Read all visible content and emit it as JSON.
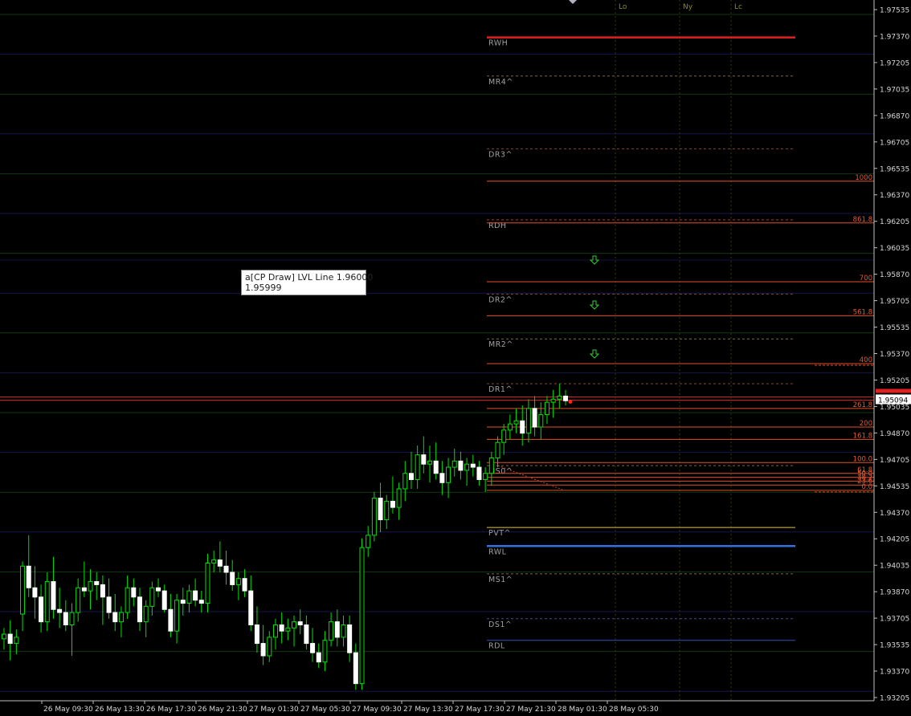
{
  "chart_data": {
    "type": "candlestick",
    "y_axis_ticks": [
      "1.97535",
      "1.97370",
      "1.97205",
      "1.97035",
      "1.96870",
      "1.96705",
      "1.96535",
      "1.96370",
      "1.96205",
      "1.96035",
      "1.95870",
      "1.95705",
      "1.95535",
      "1.95370",
      "1.95205",
      "1.95035",
      "1.94870",
      "1.94705",
      "1.94535",
      "1.94370",
      "1.94205",
      "1.94035",
      "1.93870",
      "1.93705",
      "1.93535",
      "1.93370",
      "1.93205"
    ],
    "ylim": [
      1.9317,
      1.9762
    ],
    "x_axis_ticks": [
      "26 May 09:30",
      "26 May 13:30",
      "26 May 17:30",
      "26 May 21:30",
      "27 May 01:30",
      "27 May 05:30",
      "27 May 09:30",
      "27 May 13:30",
      "27 May 17:30",
      "27 May 21:30",
      "28 May 01:30",
      "28 May 05:30"
    ],
    "current_price": "1.95094",
    "current_price_value": 1.95094,
    "session_markers": [
      {
        "label": "Lo",
        "color": "#8a8a2a"
      },
      {
        "label": "Ny",
        "color": "#8a8a2a"
      },
      {
        "label": "Lc",
        "color": "#8a8a2a"
      }
    ],
    "pivot_levels": [
      {
        "label": "RWH",
        "value": 1.9744,
        "color": "#e02020",
        "style": "solid-thick"
      },
      {
        "label": "MR4^",
        "value": 1.9719,
        "color": "#7a6a4a",
        "style": "dashed"
      },
      {
        "label": "DR3^",
        "value": 1.9672,
        "color": "#7a4a3a",
        "style": "dashed"
      },
      {
        "label": "RDH",
        "value": 1.9626,
        "color": "#a04030",
        "style": "dashed"
      },
      {
        "label": "DR2^",
        "value": 1.9578,
        "color": "#7a4a3a",
        "style": "dashed"
      },
      {
        "label": "MR2^",
        "value": 1.9549,
        "color": "#7a6a4a",
        "style": "dashed"
      },
      {
        "label": "DR1^",
        "value": 1.952,
        "color": "#7a4a3a",
        "style": "dashed"
      },
      {
        "label": "MS0^",
        "value": 1.9467,
        "color": "#7a6a4a",
        "style": "dashed"
      },
      {
        "label": "PVT^",
        "value": 1.9427,
        "color": "#e0c050",
        "style": "solid"
      },
      {
        "label": "RWL",
        "value": 1.9415,
        "color": "#3070e0",
        "style": "solid-thick"
      },
      {
        "label": "MS1^",
        "value": 1.9397,
        "color": "#7a6a4a",
        "style": "dashed"
      },
      {
        "label": "DS1^",
        "value": 1.9368,
        "color": "#4a4a8a",
        "style": "dashed"
      },
      {
        "label": "RDL",
        "value": 1.9354,
        "color": "#3050c0",
        "style": "solid"
      }
    ],
    "fib_levels": [
      {
        "label": "1000",
        "value": 1.9651
      },
      {
        "label": "861.8",
        "value": 1.9624
      },
      {
        "label": "700",
        "value": 1.9586
      },
      {
        "label": "561.8",
        "value": 1.9564
      },
      {
        "label": "400",
        "value": 1.9533
      },
      {
        "label": "261.8",
        "value": 1.9504
      },
      {
        "label": "200",
        "value": 1.9492
      },
      {
        "label": "161.8",
        "value": 1.9484
      },
      {
        "label": "100.0",
        "value": 1.9469
      },
      {
        "label": "61.8",
        "value": 1.9462
      },
      {
        "label": "50.0",
        "value": 1.94595
      },
      {
        "label": "38.2",
        "value": 1.9457
      },
      {
        "label": "23.6",
        "value": 1.94545
      },
      {
        "label": "0.0",
        "value": 1.9451
      }
    ],
    "lvl_line_value": 1.96,
    "tooltip": {
      "line1": "a[CP Draw] LVL Line 1.96000",
      "line2": "1.95999"
    },
    "candles": [
      [
        1.9355,
        1.9362,
        1.9348,
        1.9358
      ],
      [
        1.9358,
        1.9367,
        1.9341,
        1.9352
      ],
      [
        1.9352,
        1.9361,
        1.9345,
        1.9356
      ],
      [
        1.9371,
        1.9405,
        1.936,
        1.9402
      ],
      [
        1.9402,
        1.9422,
        1.9382,
        1.9388
      ],
      [
        1.9388,
        1.9402,
        1.9368,
        1.9382
      ],
      [
        1.9382,
        1.939,
        1.9359,
        1.9366
      ],
      [
        1.9366,
        1.9398,
        1.936,
        1.9392
      ],
      [
        1.9392,
        1.9408,
        1.9368,
        1.9374
      ],
      [
        1.9374,
        1.9388,
        1.9362,
        1.9372
      ],
      [
        1.9372,
        1.938,
        1.936,
        1.9364
      ],
      [
        1.9364,
        1.9378,
        1.9344,
        1.9372
      ],
      [
        1.9372,
        1.9394,
        1.9366,
        1.9388
      ],
      [
        1.9388,
        1.9405,
        1.9382,
        1.9386
      ],
      [
        1.9386,
        1.94,
        1.9374,
        1.9392
      ],
      [
        1.9392,
        1.9398,
        1.938,
        1.939
      ],
      [
        1.939,
        1.9396,
        1.9364,
        1.9382
      ],
      [
        1.9382,
        1.9394,
        1.9368,
        1.9372
      ],
      [
        1.9372,
        1.9384,
        1.936,
        1.9366
      ],
      [
        1.9366,
        1.9376,
        1.9356,
        1.9372
      ],
      [
        1.9372,
        1.9396,
        1.9368,
        1.9388
      ],
      [
        1.9388,
        1.9394,
        1.9376,
        1.9382
      ],
      [
        1.9382,
        1.9388,
        1.936,
        1.9366
      ],
      [
        1.9366,
        1.938,
        1.9356,
        1.9376
      ],
      [
        1.9376,
        1.9392,
        1.937,
        1.9388
      ],
      [
        1.9388,
        1.9394,
        1.9382,
        1.9386
      ],
      [
        1.9386,
        1.939,
        1.9372,
        1.9374
      ],
      [
        1.9374,
        1.9384,
        1.9356,
        1.936
      ],
      [
        1.936,
        1.9384,
        1.9352,
        1.938
      ],
      [
        1.938,
        1.9388,
        1.937,
        1.9378
      ],
      [
        1.9378,
        1.939,
        1.9372,
        1.9386
      ],
      [
        1.9386,
        1.9394,
        1.9376,
        1.938
      ],
      [
        1.938,
        1.9386,
        1.9372,
        1.9378
      ],
      [
        1.9378,
        1.941,
        1.9372,
        1.9404
      ],
      [
        1.9404,
        1.9412,
        1.9398,
        1.9406
      ],
      [
        1.9406,
        1.9418,
        1.9398,
        1.9402
      ],
      [
        1.9402,
        1.9412,
        1.939,
        1.9398
      ],
      [
        1.9398,
        1.9406,
        1.9386,
        1.939
      ],
      [
        1.939,
        1.9398,
        1.938,
        1.9394
      ],
      [
        1.9394,
        1.94,
        1.9382,
        1.9386
      ],
      [
        1.9386,
        1.9396,
        1.936,
        1.9364
      ],
      [
        1.9364,
        1.9376,
        1.9346,
        1.9352
      ],
      [
        1.9352,
        1.9364,
        1.9338,
        1.9344
      ],
      [
        1.9344,
        1.936,
        1.934,
        1.9356
      ],
      [
        1.9356,
        1.9368,
        1.9348,
        1.9364
      ],
      [
        1.9364,
        1.9372,
        1.9352,
        1.936
      ],
      [
        1.936,
        1.9368,
        1.9354,
        1.9362
      ],
      [
        1.9362,
        1.937,
        1.935,
        1.9366
      ],
      [
        1.9366,
        1.9374,
        1.9358,
        1.9364
      ],
      [
        1.9364,
        1.937,
        1.9348,
        1.9352
      ],
      [
        1.9352,
        1.9362,
        1.934,
        1.9346
      ],
      [
        1.9346,
        1.9352,
        1.9336,
        1.934
      ],
      [
        1.934,
        1.936,
        1.9334,
        1.9354
      ],
      [
        1.9354,
        1.9372,
        1.935,
        1.9366
      ],
      [
        1.9366,
        1.9374,
        1.935,
        1.9356
      ],
      [
        1.9356,
        1.937,
        1.935,
        1.9364
      ],
      [
        1.9364,
        1.937,
        1.934,
        1.9346
      ],
      [
        1.9346,
        1.9352,
        1.9322,
        1.9326
      ],
      [
        1.9326,
        1.942,
        1.9322,
        1.9414
      ],
      [
        1.9414,
        1.9428,
        1.9408,
        1.9422
      ],
      [
        1.9422,
        1.945,
        1.9418,
        1.9446
      ],
      [
        1.9446,
        1.9456,
        1.9424,
        1.9432
      ],
      [
        1.9432,
        1.9448,
        1.9426,
        1.9444
      ],
      [
        1.9444,
        1.946,
        1.9436,
        1.944
      ],
      [
        1.944,
        1.9456,
        1.9432,
        1.9452
      ],
      [
        1.9452,
        1.947,
        1.9444,
        1.9462
      ],
      [
        1.9462,
        1.9476,
        1.9452,
        1.9458
      ],
      [
        1.9458,
        1.948,
        1.9452,
        1.9474
      ],
      [
        1.9474,
        1.9486,
        1.9462,
        1.9468
      ],
      [
        1.9468,
        1.948,
        1.9456,
        1.947
      ],
      [
        1.947,
        1.9482,
        1.9458,
        1.9462
      ],
      [
        1.9462,
        1.947,
        1.9448,
        1.9456
      ],
      [
        1.9456,
        1.9472,
        1.9446,
        1.9466
      ],
      [
        1.9466,
        1.9478,
        1.946,
        1.947
      ],
      [
        1.947,
        1.9476,
        1.9458,
        1.9464
      ],
      [
        1.9464,
        1.9472,
        1.9454,
        1.9468
      ],
      [
        1.9468,
        1.9474,
        1.946,
        1.9466
      ],
      [
        1.9466,
        1.947,
        1.9454,
        1.9458
      ],
      [
        1.9458,
        1.9466,
        1.945,
        1.9462
      ],
      [
        1.9462,
        1.9476,
        1.9454,
        1.9472
      ],
      [
        1.9472,
        1.9486,
        1.9466,
        1.9482
      ],
      [
        1.9482,
        1.9494,
        1.9474,
        1.949
      ],
      [
        1.949,
        1.95,
        1.9484,
        1.9494
      ],
      [
        1.9494,
        1.9504,
        1.9488,
        1.9496
      ],
      [
        1.9496,
        1.9506,
        1.948,
        1.9488
      ],
      [
        1.9488,
        1.951,
        1.9482,
        1.9504
      ],
      [
        1.9504,
        1.9512,
        1.9486,
        1.9492
      ],
      [
        1.9492,
        1.9508,
        1.9484,
        1.95
      ],
      [
        1.95,
        1.9512,
        1.9494,
        1.9508
      ],
      [
        1.9508,
        1.9516,
        1.9498,
        1.951
      ],
      [
        1.951,
        1.952,
        1.9504,
        1.9512
      ],
      [
        1.9512,
        1.9516,
        1.9506,
        1.9509
      ]
    ]
  }
}
